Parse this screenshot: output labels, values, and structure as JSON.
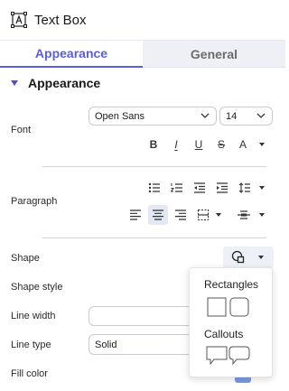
{
  "header": {
    "title": "Text Box",
    "icon": "text-box-icon"
  },
  "tabs": [
    {
      "label": "Appearance",
      "active": true
    },
    {
      "label": "General",
      "active": false
    }
  ],
  "section": {
    "label": "Appearance"
  },
  "font": {
    "label": "Font",
    "family": "Open Sans",
    "size": "14",
    "styles": [
      "bold-icon",
      "italic-icon",
      "underline-icon",
      "strikethrough-icon",
      "font-color-icon"
    ],
    "bold_glyph": "B",
    "italic_glyph": "I",
    "underline_glyph": "U",
    "strike_glyph": "S",
    "color_glyph": "A"
  },
  "paragraph": {
    "label": "Paragraph",
    "row1": [
      "bulleted-list-icon",
      "numbered-list-icon",
      "decrease-indent-icon",
      "increase-indent-icon",
      "line-spacing-icon"
    ],
    "row2": [
      "align-left-icon",
      "align-center-icon",
      "align-right-icon",
      "vertical-align-icon",
      "text-direction-icon"
    ],
    "active_alignment": "center"
  },
  "shape": {
    "label": "Shape",
    "icon": "shape-icon"
  },
  "shape_style": {
    "label": "Shape style"
  },
  "line_width": {
    "label": "Line width",
    "value": ""
  },
  "line_type": {
    "label": "Line type",
    "value": "Solid"
  },
  "fill_color": {
    "label": "Fill color"
  },
  "shape_popup": {
    "groups": [
      {
        "title": "Rectangles",
        "items": [
          "rectangle-shape",
          "rounded-rectangle-shape"
        ]
      },
      {
        "title": "Callouts",
        "items": [
          "rectangle-callout-shape",
          "rounded-callout-shape"
        ]
      }
    ]
  },
  "colors": {
    "accent": "#5a5ee0",
    "caret": "#4a4fd8",
    "pressed": "#e4e8f5",
    "toggle": "#7a9be0"
  }
}
